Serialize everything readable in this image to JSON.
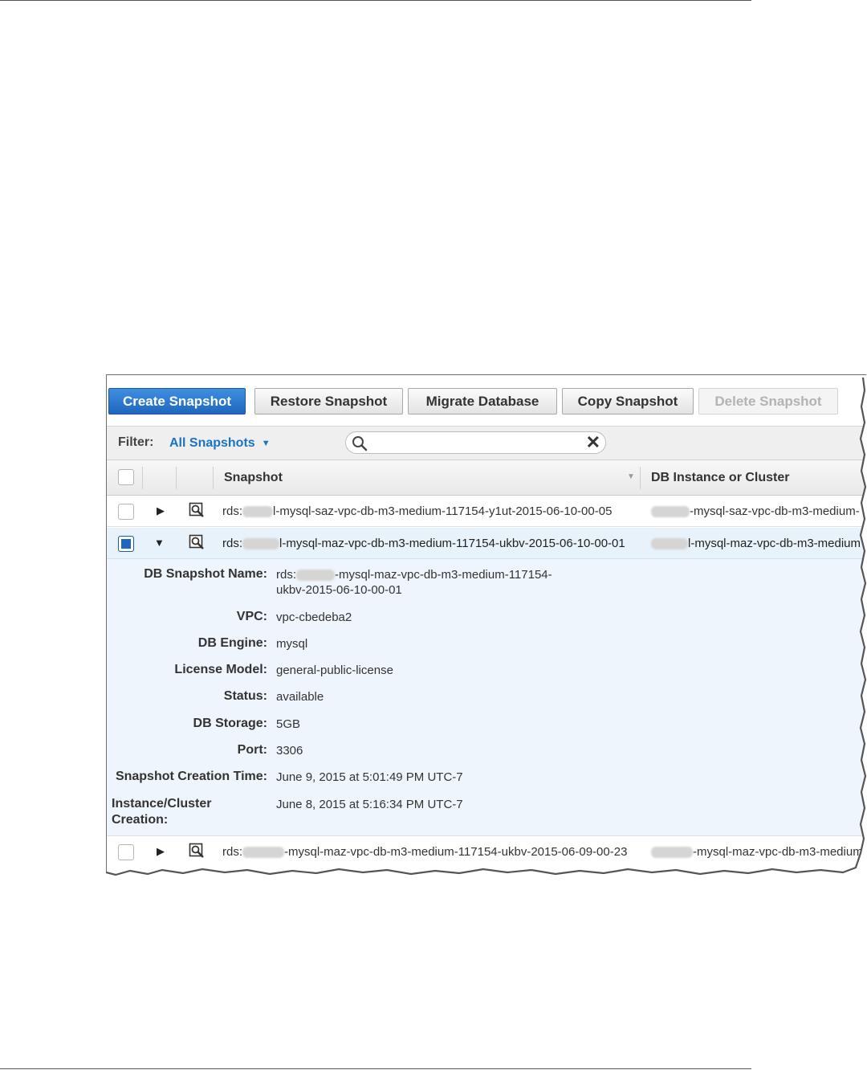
{
  "toolbar": {
    "create_label": "Create Snapshot",
    "restore_label": "Restore Snapshot",
    "migrate_label": "Migrate Database",
    "copy_label": "Copy Snapshot",
    "delete_label": "Delete Snapshot"
  },
  "filter": {
    "label": "Filter:",
    "selected": "All Snapshots",
    "search_value": ""
  },
  "table": {
    "headers": {
      "snapshot": "Snapshot",
      "instance": "DB Instance or Cluster"
    },
    "rows": [
      {
        "snapshot_prefix": "rds:",
        "snapshot_suffix": "l-mysql-saz-vpc-db-m3-medium-117154-y1ut-2015-06-10-00-05",
        "instance_suffix": "-mysql-saz-vpc-db-m3-medium-"
      },
      {
        "snapshot_prefix": "rds:",
        "snapshot_suffix": "l-mysql-maz-vpc-db-m3-medium-117154-ukbv-2015-06-10-00-01",
        "instance_suffix": "l-mysql-maz-vpc-db-m3-medium"
      },
      {
        "snapshot_prefix": "rds:",
        "snapshot_suffix": "-mysql-maz-vpc-db-m3-medium-117154-ukbv-2015-06-09-00-23",
        "instance_suffix": "-mysql-maz-vpc-db-m3-medium"
      }
    ]
  },
  "detail": {
    "name_label": "DB Snapshot Name:",
    "name_prefix": "rds:",
    "name_suffix": "-mysql-maz-vpc-db-m3-medium-117154-",
    "name_line2": "ukbv-2015-06-10-00-01",
    "vpc_label": "VPC:",
    "vpc_value": "vpc-cbedeba2",
    "engine_label": "DB Engine:",
    "engine_value": "mysql",
    "license_label": "License Model:",
    "license_value": "general-public-license",
    "status_label": "Status:",
    "status_value": "available",
    "storage_label": "DB Storage:",
    "storage_value": "5GB",
    "port_label": "Port:",
    "port_value": "3306",
    "created_label": "Snapshot Creation Time:",
    "created_value": "June 9, 2015 at 5:01:49 PM UTC-7",
    "instance_created_label_1": "Instance/Cluster",
    "instance_created_label_2": "Creation:",
    "instance_created_value": "June 8, 2015 at 5:16:34 PM UTC-7"
  }
}
